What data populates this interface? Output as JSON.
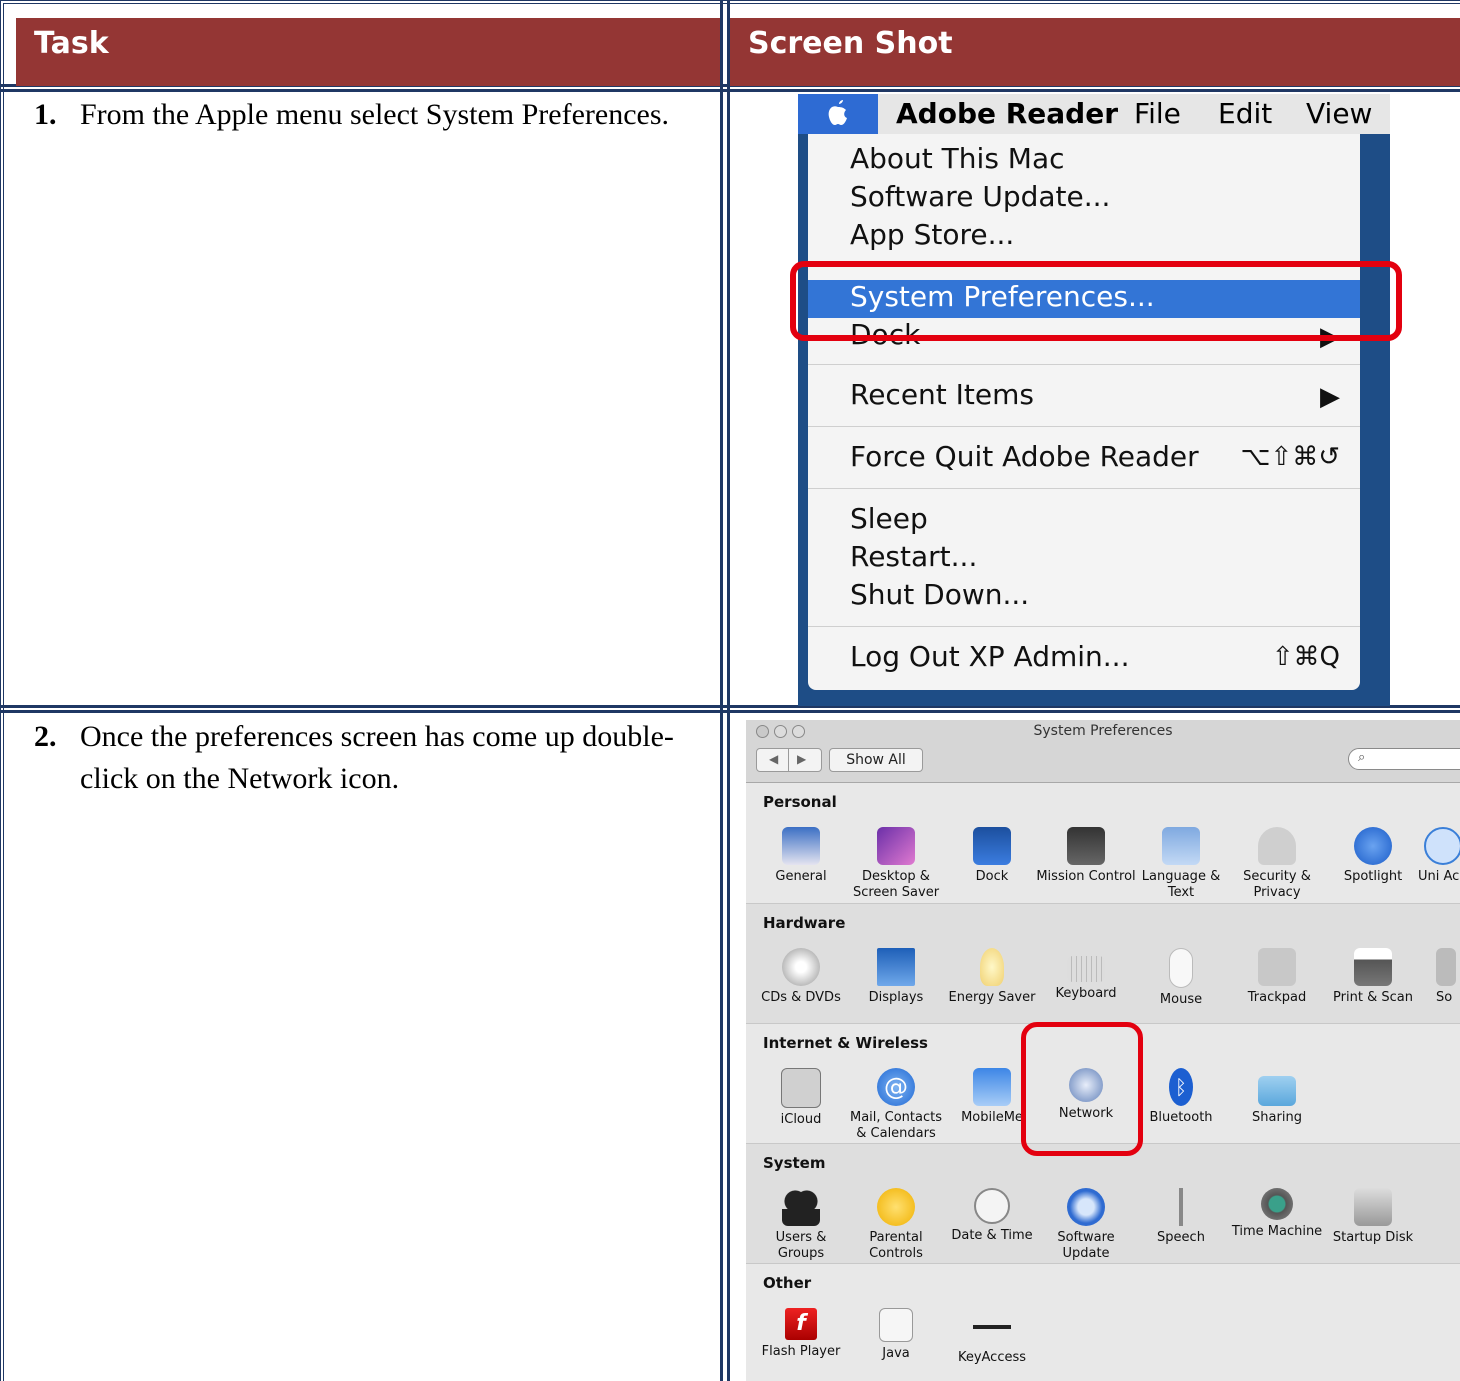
{
  "header": {
    "task": "Task",
    "screenshot": "Screen Shot"
  },
  "steps": [
    {
      "num": "1.",
      "text": "From the Apple menu select System Preferences."
    },
    {
      "num": "2.",
      "text": "Once the preferences screen has come up double-click on the Network icon."
    }
  ],
  "apple_menu": {
    "menubar": [
      "Adobe Reader",
      "File",
      "Edit",
      "View"
    ],
    "items": {
      "about": "About This Mac",
      "update": "Software Update...",
      "store": "App Store...",
      "sysprefs": "System Preferences...",
      "dock": "Dock",
      "recent": "Recent Items",
      "forcequit": "Force Quit Adobe Reader",
      "forcequit_sc": "⌥⇧⌘↺",
      "sleep": "Sleep",
      "restart": "Restart...",
      "shutdown": "Shut Down...",
      "logout": "Log Out XP Admin...",
      "logout_sc": "⇧⌘Q"
    },
    "highlight_color": "#3375d6"
  },
  "sysprefs": {
    "title": "System Preferences",
    "show_all": "Show All",
    "sections": {
      "personal": {
        "title": "Personal",
        "items": [
          "General",
          "Desktop & Screen Saver",
          "Dock",
          "Mission Control",
          "Language & Text",
          "Security & Privacy",
          "Spotlight",
          "Uni Ac"
        ]
      },
      "hardware": {
        "title": "Hardware",
        "items": [
          "CDs & DVDs",
          "Displays",
          "Energy Saver",
          "Keyboard",
          "Mouse",
          "Trackpad",
          "Print & Scan",
          "So"
        ]
      },
      "internet": {
        "title": "Internet & Wireless",
        "items": [
          "iCloud",
          "Mail, Contacts & Calendars",
          "MobileMe",
          "Network",
          "Bluetooth",
          "Sharing"
        ]
      },
      "system": {
        "title": "System",
        "items": [
          "Users & Groups",
          "Parental Controls",
          "Date & Time",
          "Software Update",
          "Speech",
          "Time Machine",
          "Startup Disk"
        ]
      },
      "other": {
        "title": "Other",
        "items": [
          "Flash Player",
          "Java",
          "KeyAccess"
        ]
      }
    }
  },
  "colors": {
    "header_bg": "#943634",
    "border": "#1f3864",
    "callout": "#e3000f"
  }
}
